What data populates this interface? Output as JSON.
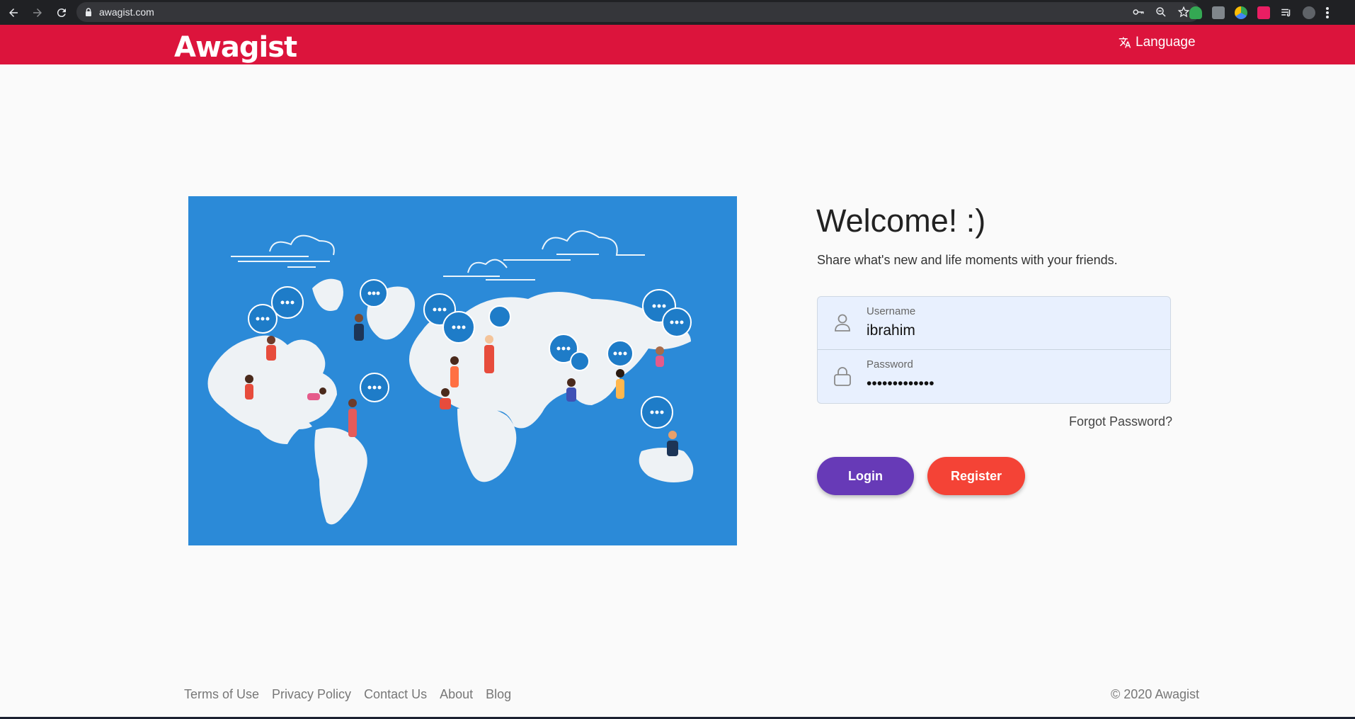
{
  "browser": {
    "url": "awagist.com"
  },
  "header": {
    "logo_text": "Awagist",
    "language_label": "Language"
  },
  "hero": {
    "image_name": "world-map-people-illustration"
  },
  "login": {
    "title": "Welcome! :)",
    "tagline": "Share what's new and life moments with your friends.",
    "username_label": "Username",
    "username_value": "ibrahim",
    "password_label": "Password",
    "password_value": "•••••••••••••",
    "forgot_label": "Forgot Password?",
    "login_button": "Login",
    "register_button": "Register"
  },
  "footer": {
    "links": [
      "Terms of Use",
      "Privacy Policy",
      "Contact Us",
      "About",
      "Blog"
    ],
    "copyright": "© 2020 Awagist"
  },
  "colors": {
    "brand": "#dc143c",
    "login": "#673ab7",
    "register": "#f44336",
    "hero_bg": "#2b8ad8"
  }
}
